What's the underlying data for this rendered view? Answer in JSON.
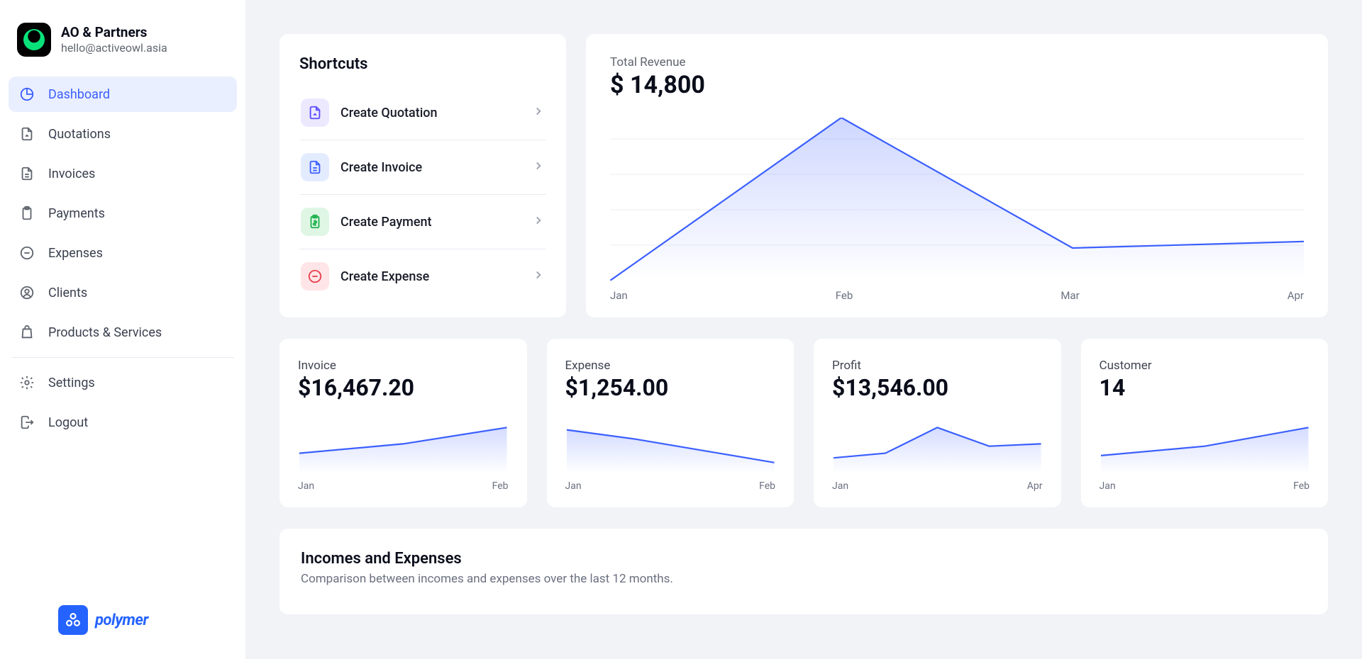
{
  "org": {
    "name": "AO & Partners",
    "email": "hello@activeowl.asia"
  },
  "brand": {
    "name": "polymer"
  },
  "nav": {
    "items": [
      {
        "label": "Dashboard",
        "icon": "pie-chart-icon",
        "active": true
      },
      {
        "label": "Quotations",
        "icon": "document-edit-icon"
      },
      {
        "label": "Invoices",
        "icon": "document-text-icon"
      },
      {
        "label": "Payments",
        "icon": "clipboard-icon"
      },
      {
        "label": "Expenses",
        "icon": "minus-circle-icon"
      },
      {
        "label": "Clients",
        "icon": "user-circle-icon"
      },
      {
        "label": "Products & Services",
        "icon": "shopping-bag-icon"
      }
    ],
    "secondary": [
      {
        "label": "Settings",
        "icon": "gear-icon"
      },
      {
        "label": "Logout",
        "icon": "logout-icon"
      }
    ]
  },
  "shortcuts": {
    "title": "Shortcuts",
    "items": [
      {
        "label": "Create Quotation",
        "icon": "document-edit-icon",
        "icon_bg": "#ece9ff",
        "icon_color": "#5a4dff"
      },
      {
        "label": "Create Invoice",
        "icon": "document-text-icon",
        "icon_bg": "#e3ecff",
        "icon_color": "#3b5fff"
      },
      {
        "label": "Create Payment",
        "icon": "clipboard-money-icon",
        "icon_bg": "#e0f6e5",
        "icon_color": "#1fb24e"
      },
      {
        "label": "Create Expense",
        "icon": "minus-circle-icon",
        "icon_bg": "#ffe5e7",
        "icon_color": "#e8404e"
      }
    ]
  },
  "revenue": {
    "label": "Total Revenue",
    "value": "$ 14,800"
  },
  "kpis": [
    {
      "label": "Invoice",
      "value": "$16,467.20",
      "x_start": "Jan",
      "x_end": "Feb",
      "series": [
        40,
        60,
        95
      ]
    },
    {
      "label": "Expense",
      "value": "$1,254.00",
      "x_start": "Jan",
      "x_end": "Feb",
      "series": [
        90,
        70,
        45,
        20
      ]
    },
    {
      "label": "Profit",
      "value": "$13,546.00",
      "x_start": "Jan",
      "x_end": "Apr",
      "series": [
        30,
        40,
        95,
        55,
        60
      ]
    },
    {
      "label": "Customer",
      "value": "14",
      "x_start": "Jan",
      "x_end": "Feb",
      "series": [
        35,
        55,
        95
      ]
    }
  ],
  "incomes": {
    "title": "Incomes and Expenses",
    "subtitle": "Comparison between incomes and expenses over the last 12 months."
  },
  "chart_data": {
    "type": "area",
    "categories": [
      "Jan",
      "Feb",
      "Mar",
      "Apr"
    ],
    "values": [
      0,
      100,
      20,
      24
    ],
    "title": "Total Revenue",
    "xlabel": "",
    "ylabel": "",
    "ylim": [
      0,
      100
    ]
  },
  "colors": {
    "accent": "#3b5fff"
  }
}
